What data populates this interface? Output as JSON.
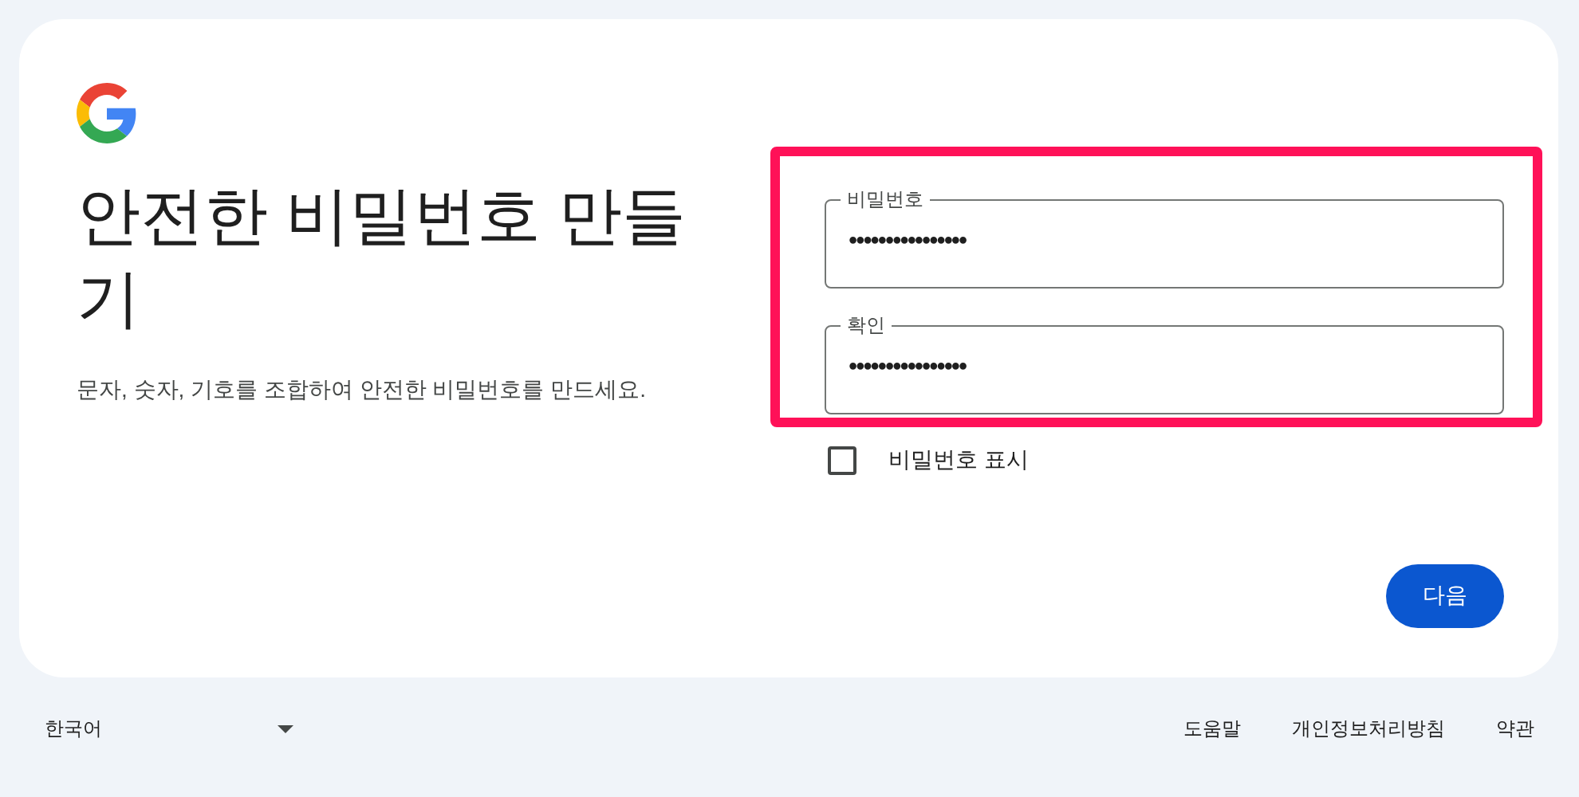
{
  "title": "안전한 비밀번호 만들기",
  "description": "문자, 숫자, 기호를 조합하여 안전한 비밀번호를 만드세요.",
  "fields": [
    {
      "label": "비밀번호",
      "value": "••••••••••••••••"
    },
    {
      "label": "확인",
      "value": "••••••••••••••••"
    }
  ],
  "show_password": {
    "label": "비밀번호 표시",
    "checked": false
  },
  "next_button": "다음",
  "highlight": {
    "kind": "annotation",
    "color": "#ff1158"
  },
  "footer": {
    "language": "한국어",
    "links": [
      "도움말",
      "개인정보처리방침",
      "약관"
    ]
  }
}
